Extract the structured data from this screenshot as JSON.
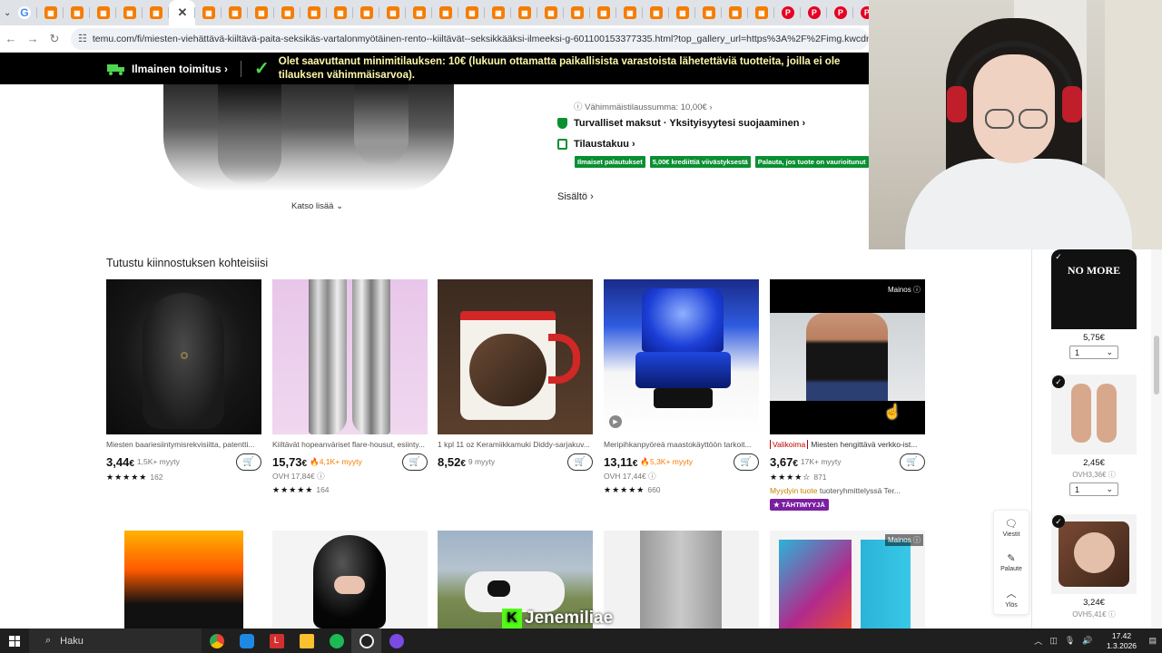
{
  "browser": {
    "url": "temu.com/fi/miesten-viehättävä-kiiltävä-paita-seksikäs-vartalonmyötäinen-rento--kiiltävät--seksikkääksi-ilmeeksi-g-601100153377335.html?top_gallery_url=https%3A%2F%2Fimg.kwcdn.com%2Fproduct%2Ff",
    "tabs": [
      "g",
      "t",
      "t",
      "t",
      "t",
      "t",
      "x",
      "t",
      "t",
      "t",
      "t",
      "t",
      "t",
      "t",
      "t",
      "t",
      "t",
      "t",
      "t",
      "t",
      "t",
      "t",
      "t",
      "t",
      "t",
      "t",
      "t",
      "t",
      "t",
      "p",
      "p",
      "p",
      "p"
    ]
  },
  "banner": {
    "free_shipping": "Ilmainen toimitus",
    "message": "Olet saavuttanut minimitilauksen: 10€ (lukuun ottamatta paikallisista varastoista lähetettäviä tuotteita, joilla ei ole tilauksen vähimmäisarvoa)."
  },
  "product": {
    "see_more": "Katso lisää",
    "min_sum": "Vähimmäistilaussumma: 10,00€",
    "secure": "Turvalliset maksut · Yksityisyytesi suojaaminen",
    "order": "Tilaustakuu",
    "badges": [
      "Ilmaiset palautukset",
      "5,00€ krediittiä viivästyksestä",
      "Palauta, jos tuote on vaurioitunut"
    ],
    "contents": "Sisältö"
  },
  "section_title": "Tutustu kiinnostuksen kohteisiisi",
  "cards": [
    {
      "title": "Miesten baariesiintymisrekvisiitta, patentti...",
      "price_main": "3,44",
      "price_unit": "€",
      "sold": "1,5K+ myyty",
      "hot": false,
      "old": "",
      "rating": "162"
    },
    {
      "title": "Kiiltävät hopeanväriset flare-housut, esiinty...",
      "price_main": "15,73",
      "price_unit": "€",
      "sold": "4,1K+ myyty",
      "hot": true,
      "old": "OVH 17,84€",
      "rating": "164"
    },
    {
      "title": "1 kpl 11 oz Keramiikkamuki Diddy-sarjakuv...",
      "price_main": "8,52",
      "price_unit": "€",
      "sold": "9 myyty",
      "hot": false,
      "old": "",
      "rating": ""
    },
    {
      "title": "Meripihkanpyöreä maastokäyttöön tarkoit...",
      "price_main": "13,11",
      "price_unit": "€",
      "sold": "5,3K+ myyty",
      "hot": true,
      "old": "OVH 17,44€",
      "rating": "660"
    },
    {
      "title": "Miesten hengittävä verkko-ist...",
      "selection": "Valikoima",
      "price_main": "3,67",
      "price_unit": "€",
      "sold": "17K+ myyty",
      "hot": false,
      "old": "",
      "rating": "871",
      "promo": "Myydyin tuote",
      "promo_rest": "tuoteryhmittelyssä Ter...",
      "badge": "TÄHTIMYYJÄ",
      "ad": "Mainos"
    }
  ],
  "row2_ad": "Mainos",
  "cart_sidebar": {
    "items": [
      {
        "price": "5,75€",
        "old": "",
        "qty": "1",
        "label": "NO MORE"
      },
      {
        "price": "2,45€",
        "old": "OVH3,36€",
        "qty": "1"
      },
      {
        "price": "3,24€",
        "old": "OVH5,41€",
        "qty": ""
      }
    ]
  },
  "float_menu": {
    "messages": "Viestit",
    "returns": "Palaute",
    "up": "Ylös"
  },
  "overlay": {
    "streamer": "Jenemiliae"
  },
  "taskbar": {
    "search": "Haku",
    "time": "17.42",
    "date": "1.3.2026"
  }
}
